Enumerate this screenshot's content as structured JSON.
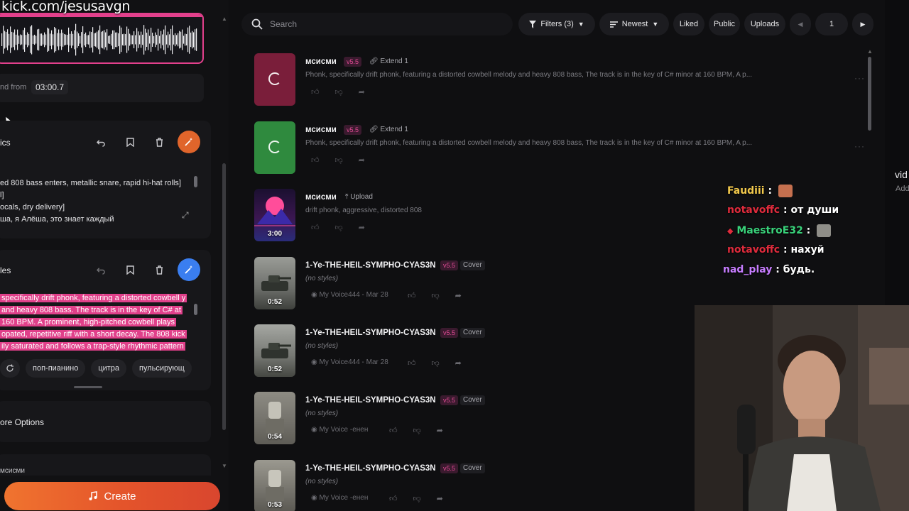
{
  "overlay": {
    "watermark": "kick.com/jesusavgn",
    "chat": [
      {
        "user": "Faudiii",
        "text": "",
        "user_color": "#f2c94c",
        "emote": true
      },
      {
        "user": "notavoffc",
        "text": "от души",
        "user_color": "#e02b3c",
        "emote": false
      },
      {
        "user": "MaestroE32",
        "text": "",
        "user_color": "#39d27a",
        "emote": true
      },
      {
        "user": "notavoffc",
        "text": "нахуй",
        "user_color": "#e02b3c",
        "emote": false
      },
      {
        "user": "nad_play",
        "text": "будь.",
        "user_color": "#c77dff",
        "emote": false
      }
    ],
    "side_text": "vid",
    "side_sub": "Add"
  },
  "left_panel": {
    "extend_label": "nd from",
    "extend_time": "03:00.7",
    "lyrics": {
      "title": "ics",
      "lines": [
        "ed 808 bass enters, metallic snare, rapid hi-hat rolls]",
        "l]",
        "ocals, dry delivery]",
        "ша, я Алёша, это знает каждый"
      ]
    },
    "styles": {
      "title": "les",
      "text": "specifically drift phonk, featuring a distorted cowbell y and heavy 808 bass. The track is in the key of C# at 160 BPM. A prominent, high-pitched cowbell plays opated, repetitive riff with a short decay. The 808 kick ily saturated and follows a trap-style rhythmic pattern",
      "chips": [
        "поп-пианино",
        "цитра",
        "пульсирующ"
      ]
    },
    "more_options": "ore Options",
    "workspace": "мсисми",
    "create": "Create"
  },
  "toolbar": {
    "search_placeholder": "Search",
    "filters": "Filters (3)",
    "sort": "Newest",
    "liked": "Liked",
    "public": "Public",
    "uploads": "Uploads",
    "page": "1"
  },
  "songs": [
    {
      "title": "мсисми",
      "version": "v5.5",
      "kind": "Extend 1",
      "kind_icon": "link-icon",
      "desc": "Phonk, specifically drift phonk, featuring a distorted cowbell melody and heavy 808 bass, The track is in the key of C# minor at 160 BPM, A p...",
      "duration": "",
      "thumb": "loading-red",
      "meta": ""
    },
    {
      "title": "мсисми",
      "version": "v5.5",
      "kind": "Extend 1",
      "kind_icon": "link-icon",
      "desc": "Phonk, specifically drift phonk, featuring a distorted cowbell melody and heavy 808 bass, The track is in the key of C# minor at 160 BPM, A p...",
      "duration": "",
      "thumb": "loading-green",
      "meta": ""
    },
    {
      "title": "мсисми",
      "version": "",
      "kind": "Upload",
      "kind_icon": "upload-icon",
      "desc": "drift phonk, aggressive, distorted 808",
      "duration": "3:00",
      "thumb": "synthwave",
      "meta": ""
    },
    {
      "title": "1-Ye-THE-HEIL-SYMPHO-CYAS3N",
      "version": "v5.5",
      "kind": "Cover",
      "kind_icon": "",
      "desc": "(no styles)",
      "duration": "0:52",
      "thumb": "tank",
      "meta": "My Voice444 - Mar 28"
    },
    {
      "title": "1-Ye-THE-HEIL-SYMPHO-CYAS3N",
      "version": "v5.5",
      "kind": "Cover",
      "kind_icon": "",
      "desc": "(no styles)",
      "duration": "0:52",
      "thumb": "tank",
      "meta": "My Voice444 - Mar 28"
    },
    {
      "title": "1-Ye-THE-HEIL-SYMPHO-CYAS3N",
      "version": "v5.5",
      "kind": "Cover",
      "kind_icon": "",
      "desc": "(no styles)",
      "duration": "0:54",
      "thumb": "statue",
      "meta": "My Voice -енен"
    },
    {
      "title": "1-Ye-THE-HEIL-SYMPHO-CYAS3N",
      "version": "v5.5",
      "kind": "Cover",
      "kind_icon": "",
      "desc": "(no styles)",
      "duration": "0:53",
      "thumb": "statue",
      "meta": "My Voice -енен"
    }
  ]
}
